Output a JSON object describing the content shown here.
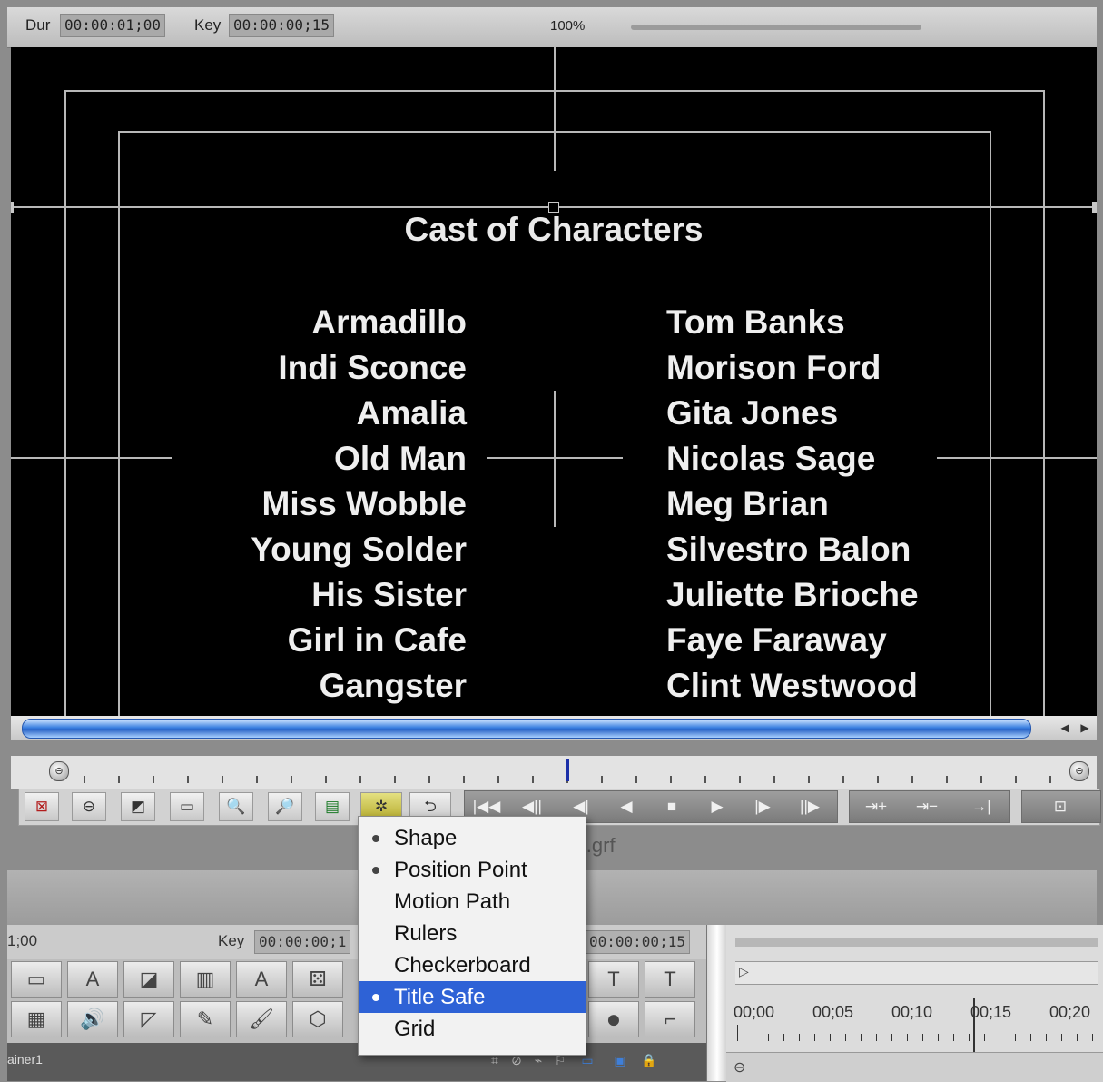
{
  "viewer": {
    "dur_label": "Dur",
    "dur_value": "00:00:01;00",
    "key_label": "Key",
    "key_value": "00:00:00;15",
    "zoom": "100%"
  },
  "title_card": {
    "heading": "Cast of Characters",
    "roles": [
      "Armadillo",
      "Indi Sconce",
      "Amalia",
      "Old Man",
      "Miss Wobble",
      "Young Solder",
      "His Sister",
      "Girl in Cafe",
      "Gangster"
    ],
    "actors": [
      "Tom Banks",
      "Morison Ford",
      "Gita Jones",
      "Nicolas Sage",
      "Meg Brian",
      "Silvestro Balon",
      "Juliette Brioche",
      "Faye Faraway",
      "Clint Westwood"
    ]
  },
  "overlay_menu": {
    "items": [
      {
        "label": "Shape",
        "checked": true,
        "selected": false
      },
      {
        "label": "Position Point",
        "checked": true,
        "selected": false
      },
      {
        "label": "Motion Path",
        "checked": false,
        "selected": false
      },
      {
        "label": "Rulers",
        "checked": false,
        "selected": false
      },
      {
        "label": "Checkerboard",
        "checked": false,
        "selected": false
      },
      {
        "label": "Title Safe",
        "checked": true,
        "selected": true
      },
      {
        "label": "Grid",
        "checked": false,
        "selected": false
      }
    ]
  },
  "lower": {
    "filename_fragment": "ll.grf",
    "dur_fragment": "1;00",
    "key_label": "Key",
    "key_value": "00:00:00;1",
    "out_value": "00:00:00;15",
    "status_name": "ainer1",
    "timeline_labels": [
      "00;00",
      "00;05",
      "00;10",
      "00;15",
      "00;20"
    ]
  },
  "colors": {
    "canvas_bg": "#000000",
    "scroll_thumb": "#3a7fe0",
    "menu_highlight": "#2e62d6",
    "playhead": "#1b2fa8"
  }
}
